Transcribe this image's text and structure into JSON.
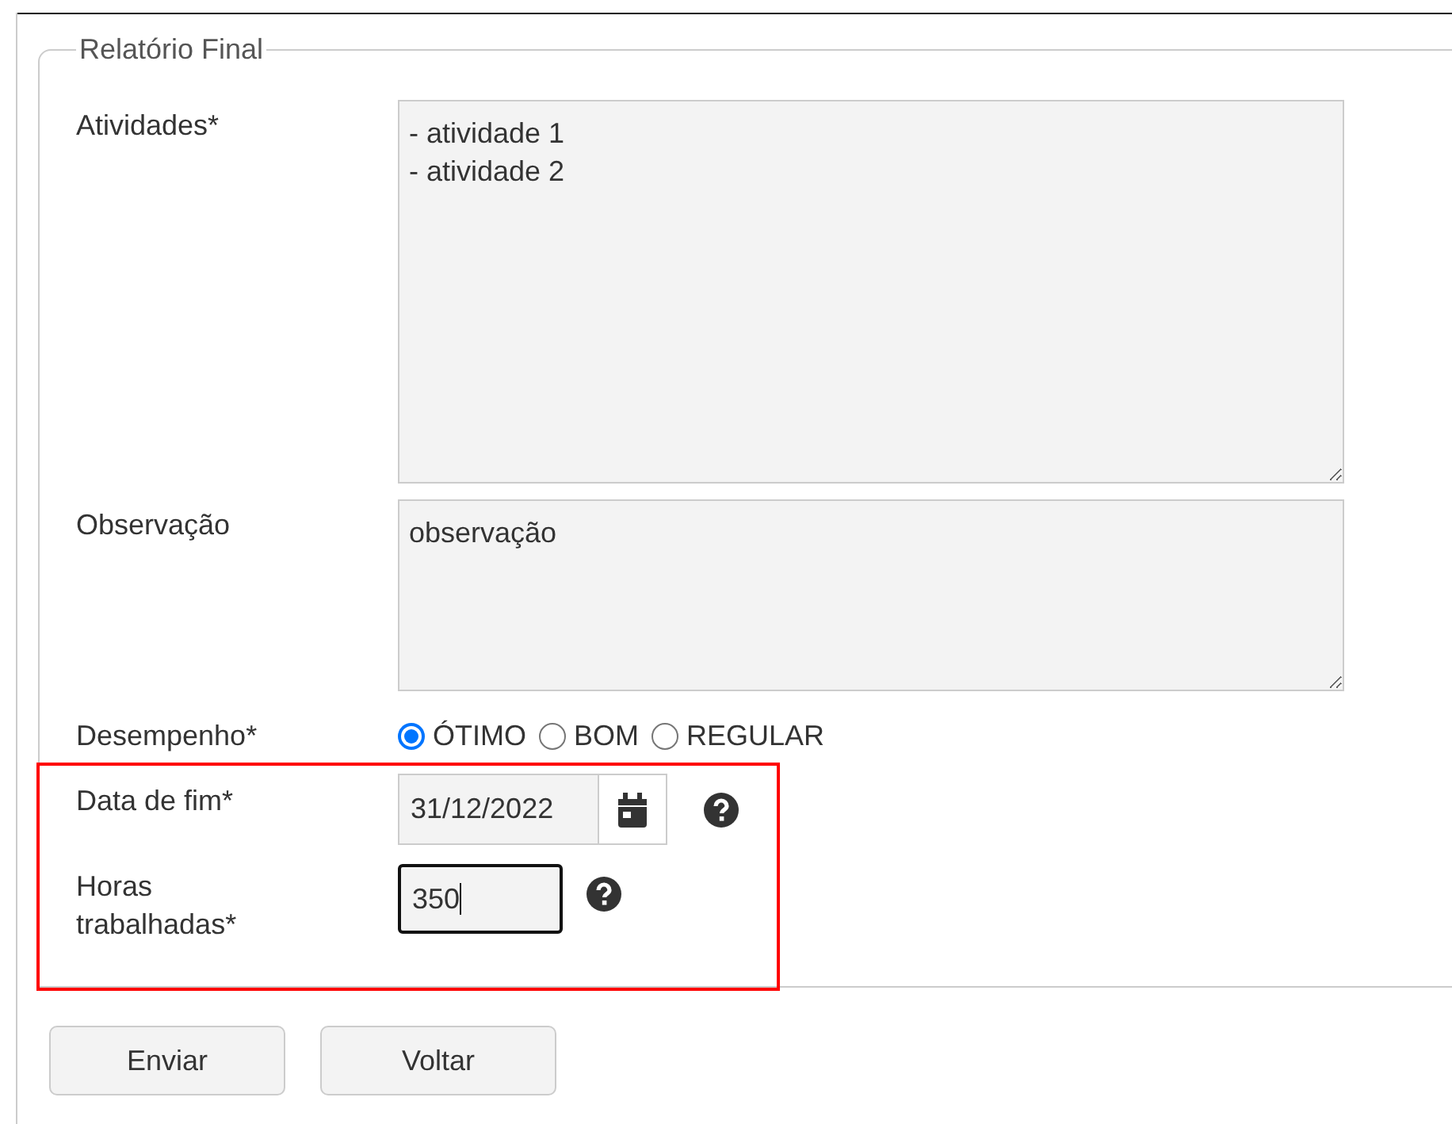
{
  "fieldset": {
    "legend": "Relatório Final"
  },
  "activities": {
    "label": "Atividades*",
    "value": "- atividade 1\n- atividade 2"
  },
  "notes": {
    "label": "Observação",
    "value": "observação"
  },
  "performance": {
    "label": "Desempenho*",
    "options": [
      {
        "label": "ÓTIMO",
        "selected": true
      },
      {
        "label": "BOM",
        "selected": false
      },
      {
        "label": "REGULAR",
        "selected": false
      }
    ]
  },
  "end_date": {
    "label": "Data de fim*",
    "value": "31/12/2022"
  },
  "hours": {
    "label": "Horas trabalhadas*",
    "value": "350",
    "focused": true
  },
  "buttons": [
    "Enviar",
    "Voltar"
  ]
}
